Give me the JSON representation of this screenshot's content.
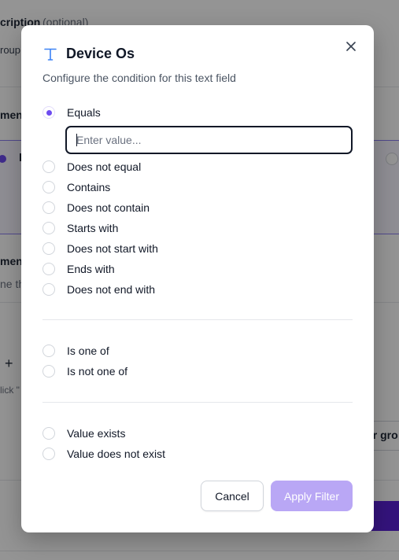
{
  "background": {
    "texts": {
      "description_label": "cription",
      "optional": "(optional)",
      "group": "roup",
      "men1": "men",
      "men2": "men",
      "ne_th": "ne th",
      "plus": "+",
      "click": "lick \"",
      "er_gro": "er gro",
      "i_label": "I"
    }
  },
  "modal": {
    "title": "Device Os",
    "title_icon": "text-type-icon",
    "subtitle": "Configure the condition for this text field",
    "close_icon": "close-icon",
    "input_placeholder": "Enter value...",
    "group1": [
      {
        "label": "Equals",
        "checked": true
      },
      {
        "label": "Does not equal",
        "checked": false
      },
      {
        "label": "Contains",
        "checked": false
      },
      {
        "label": "Does not contain",
        "checked": false
      },
      {
        "label": "Starts with",
        "checked": false
      },
      {
        "label": "Does not start with",
        "checked": false
      },
      {
        "label": "Ends with",
        "checked": false
      },
      {
        "label": "Does not end with",
        "checked": false
      }
    ],
    "group2": [
      {
        "label": "Is one of",
        "checked": false
      },
      {
        "label": "Is not one of",
        "checked": false
      }
    ],
    "group3": [
      {
        "label": "Value exists",
        "checked": false
      },
      {
        "label": "Value does not exist",
        "checked": false
      }
    ],
    "cancel_label": "Cancel",
    "apply_label": "Apply Filter"
  },
  "colors": {
    "accent": "#6d4bf0",
    "apply_disabled": "#b9a7f5",
    "overlay": "rgba(0,0,0,0.42)"
  }
}
